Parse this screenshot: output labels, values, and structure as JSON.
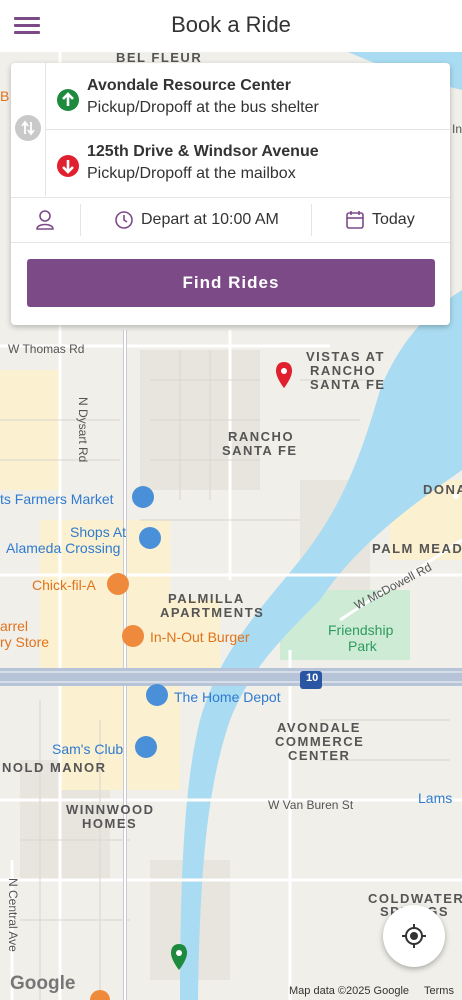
{
  "header": {
    "title": "Book a Ride",
    "menu_icon": "hamburger-menu-icon"
  },
  "trip": {
    "pickup": {
      "name": "Avondale Resource Center",
      "detail": "Pickup/Dropoff at the bus shelter",
      "icon": "arrow-up-circle-icon",
      "color": "#1e8a3e"
    },
    "dropoff": {
      "name": "125th Drive & Windsor Avenue",
      "detail": "Pickup/Dropoff at the mailbox",
      "icon": "arrow-down-circle-icon",
      "color": "#e0202f"
    },
    "swap_icon": "swap-vertical-icon"
  },
  "options": {
    "rider_icon": "person-icon",
    "depart_label": "Depart at 10:00 AM",
    "date_label": "Today"
  },
  "find_button": "Find Rides",
  "map": {
    "areas": {
      "bel_fleur": "BEL FLEUR",
      "vistas_1": "VISTAS AT",
      "vistas_2": "RANCHO",
      "vistas_3": "SANTA FE",
      "rancho_1": "RANCHO",
      "rancho_2": "SANTA FE",
      "palmilla_1": "PALMILLA",
      "palmilla_2": "APARTMENTS",
      "dona": "DONA",
      "palm_meado": "PALM MEADO",
      "avondale_1": "AVONDALE",
      "avondale_2": "COMMERCE",
      "avondale_3": "CENTER",
      "nold_manor": "NOLD MANOR",
      "winnwood_1": "WINNWOOD",
      "winnwood_2": "HOMES",
      "coldwater_1": "COLDWATER",
      "coldwater_2": "SPRINGS"
    },
    "streets": {
      "thomas": "W Thomas Rd",
      "dysart": "N Dysart Rd",
      "mcdowell": "W McDowell Rd",
      "van_buren": "W Van Buren St",
      "central": "N Central Ave",
      "i10": "10"
    },
    "pois": {
      "farmers": "ts Farmers Market",
      "shops_1": "Shops At",
      "shops_2": "Alameda Crossing",
      "chick": "Chick-fil-A",
      "innout": "In-N-Out Burger",
      "barrel_1": "arrel",
      "barrel_2": "ry Store",
      "friendship_1": "Friendship",
      "friendship_2": "Park",
      "home_depot": "The Home Depot",
      "sams": "Sam's Club",
      "lams": "Lams",
      "edge_b": "B",
      "edge_inc": "Inc"
    },
    "google_logo": "Google",
    "attribution": "Map data ©2025 Google",
    "terms": "Terms",
    "locate_icon": "my-location-icon"
  }
}
